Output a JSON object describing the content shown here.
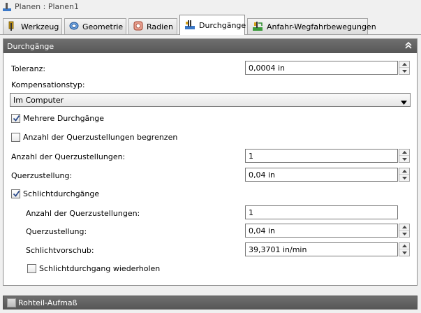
{
  "window": {
    "title": "Planen : Planen1"
  },
  "tabs": [
    {
      "label": "Werkzeug",
      "icon": "tool-icon"
    },
    {
      "label": "Geometrie",
      "icon": "geometry-icon"
    },
    {
      "label": "Radien",
      "icon": "radius-icon"
    },
    {
      "label": "Durchgänge",
      "icon": "passes-icon",
      "active": true
    },
    {
      "label": "Anfahr-Wegfahrbewegungen",
      "icon": "linking-icon"
    }
  ],
  "panel": {
    "title": "Durchgänge",
    "toleranz": {
      "label": "Toleranz:",
      "value": "0,0004 in"
    },
    "kompensationstyp": {
      "label": "Kompensationstyp:",
      "value": "Im Computer"
    },
    "mehrere_durchgaenge": {
      "label": "Mehrere Durchgänge",
      "checked": true
    },
    "anzahl_begrenzen": {
      "label": "Anzahl der Querzustellungen begrenzen",
      "checked": false
    },
    "anzahl_querzustellungen": {
      "label": "Anzahl der Querzustellungen:",
      "value": "1"
    },
    "querzustellung": {
      "label": "Querzustellung:",
      "value": "0,04 in"
    },
    "schlichtdurchgaenge": {
      "label": "Schlichtdurchgänge",
      "checked": true
    },
    "schlicht_anzahl": {
      "label": "Anzahl der Querzustellungen:",
      "value": "1"
    },
    "schlicht_querzustellung": {
      "label": "Querzustellung:",
      "value": "0,04 in"
    },
    "schlichtvorschub": {
      "label": "Schlichtvorschub:",
      "value": "39,3701 in/min"
    },
    "schlicht_wiederholen": {
      "label": "Schlichtdurchgang wiederholen",
      "checked": false
    }
  },
  "bottom_section": {
    "title": "Rohteil-Aufmaß",
    "checked": false
  },
  "colors": {
    "header_bg": "#5f5f5f",
    "active_tab_bg": "#ffffff",
    "tab_bg": "#e4e4e4"
  }
}
